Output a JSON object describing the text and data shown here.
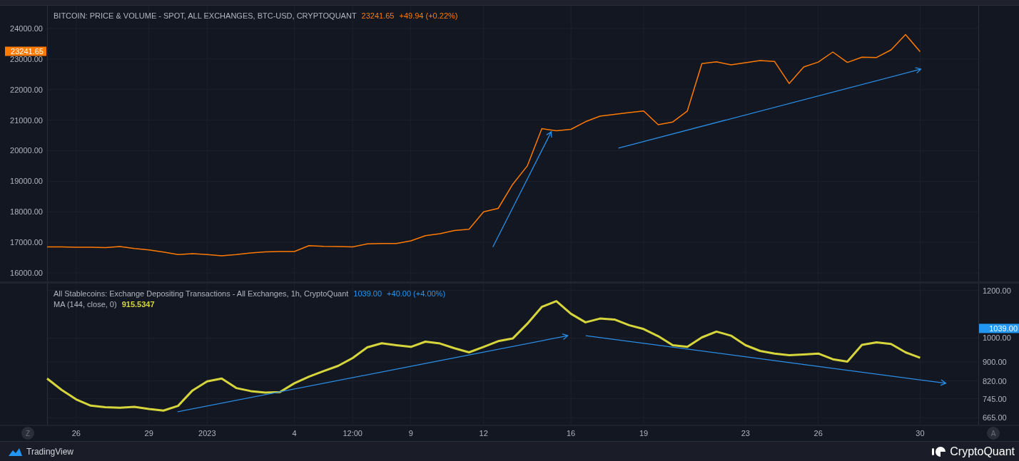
{
  "price_pane": {
    "legend": {
      "value": "23241.65",
      "change": "+49.94 (+0.22%)"
    },
    "price_tag": {
      "label": "23241.65",
      "color": "#ff7a00"
    },
    "chart_data": {
      "type": "line",
      "grid": true,
      "ylim": [
        15720,
        24746
      ],
      "yticks": [
        {
          "value": 16000,
          "label": "16000.00"
        },
        {
          "value": 17000,
          "label": "17000.00"
        },
        {
          "value": 18000,
          "label": "18000.00"
        },
        {
          "value": 19000,
          "label": "19000.00"
        },
        {
          "value": 20000,
          "label": "20000.00"
        },
        {
          "value": 21000,
          "label": "21000.00"
        },
        {
          "value": 22000,
          "label": "22000.00"
        },
        {
          "value": 23000,
          "label": "23000.00"
        },
        {
          "value": 24000,
          "label": "24000.00"
        }
      ],
      "categories": [
        null,
        null,
        null,
        null,
        null,
        null,
        null,
        null,
        null,
        null,
        null,
        null,
        null,
        null,
        null,
        null,
        null,
        null,
        null,
        null,
        null,
        null,
        null,
        null,
        null,
        null,
        null,
        null,
        null,
        null,
        null,
        null,
        null,
        null,
        null,
        null,
        null,
        null,
        null,
        null,
        null,
        null,
        null,
        null,
        null,
        null,
        null,
        null,
        null,
        null,
        null,
        null,
        null,
        null,
        null,
        null,
        null,
        null,
        null,
        null,
        null
      ],
      "series": [
        {
          "name": "BITCOIN: PRICE & VOLUME - SPOT, ALL EXCHANGES, BTC-USD, CRYPTOQUANT",
          "color": "#ff7a00",
          "values": [
            16850,
            16850,
            16840,
            16840,
            16830,
            16860,
            16800,
            16750,
            16680,
            16600,
            16630,
            16600,
            16560,
            16600,
            16650,
            16690,
            16700,
            16700,
            16890,
            16870,
            16860,
            16850,
            16950,
            16960,
            16960,
            17050,
            17220,
            17280,
            17390,
            17430,
            18000,
            18110,
            18900,
            19500,
            20720,
            20650,
            20700,
            20950,
            21130,
            21190,
            21250,
            21300,
            20850,
            20940,
            21300,
            22850,
            22910,
            22810,
            22880,
            22950,
            22920,
            22200,
            22740,
            22900,
            23230,
            22890,
            23060,
            23050,
            23300,
            23800,
            23240
          ]
        }
      ]
    }
  },
  "stablecoin_pane": {
    "legend": {
      "value": "1039.00",
      "change": "+40.00 (+4.00%)",
      "ma_value": "915.5347"
    },
    "price_tag": {
      "label": "1039.00",
      "color": "#2196f3"
    },
    "chart_data": {
      "type": "line",
      "grid": true,
      "title": "All Stablecoins: Exchange Depositing Transactions - All Exchanges, 1h, CryptoQuant",
      "ylim": [
        636,
        1229
      ],
      "categories": [
        null,
        null,
        "26",
        null,
        null,
        null,
        null,
        "29",
        null,
        null,
        null,
        "2023",
        null,
        null,
        null,
        null,
        null,
        "4",
        null,
        null,
        null,
        "12:00",
        null,
        null,
        null,
        "9",
        null,
        null,
        null,
        null,
        "12",
        null,
        null,
        null,
        null,
        null,
        "16",
        null,
        null,
        null,
        null,
        "19",
        null,
        null,
        null,
        null,
        null,
        null,
        "23",
        null,
        null,
        null,
        null,
        "26",
        null,
        null,
        null,
        null,
        null,
        null,
        "30"
      ],
      "yticks": [
        {
          "value": 665,
          "label": "665.00"
        },
        {
          "value": 745,
          "label": "745.00"
        },
        {
          "value": 820,
          "label": "820.00"
        },
        {
          "value": 900,
          "label": "900.00"
        },
        {
          "value": 1000,
          "label": "1000.00"
        },
        {
          "value": 1200,
          "label": "1200.00"
        }
      ],
      "series": [
        {
          "name": "MA (144, close, 0)",
          "color": "#d6d63c",
          "values": [
            830,
            782,
            742,
            716,
            709,
            707,
            711,
            702,
            695,
            715,
            780,
            818,
            830,
            790,
            777,
            771,
            773,
            810,
            838,
            861,
            883,
            916,
            961,
            978,
            970,
            963,
            985,
            977,
            957,
            940,
            963,
            987,
            998,
            1060,
            1131,
            1155,
            1102,
            1066,
            1082,
            1078,
            1054,
            1038,
            1008,
            970,
            963,
            1003,
            1027,
            1010,
            970,
            946,
            935,
            928,
            931,
            935,
            911,
            901,
            971,
            982,
            975,
            940,
            917
          ]
        }
      ]
    }
  },
  "time_axis": {
    "left_button": "Z",
    "right_button": "A"
  },
  "footer": {
    "left_brand": "TradingView",
    "right_brand": "CryptoQuant"
  }
}
